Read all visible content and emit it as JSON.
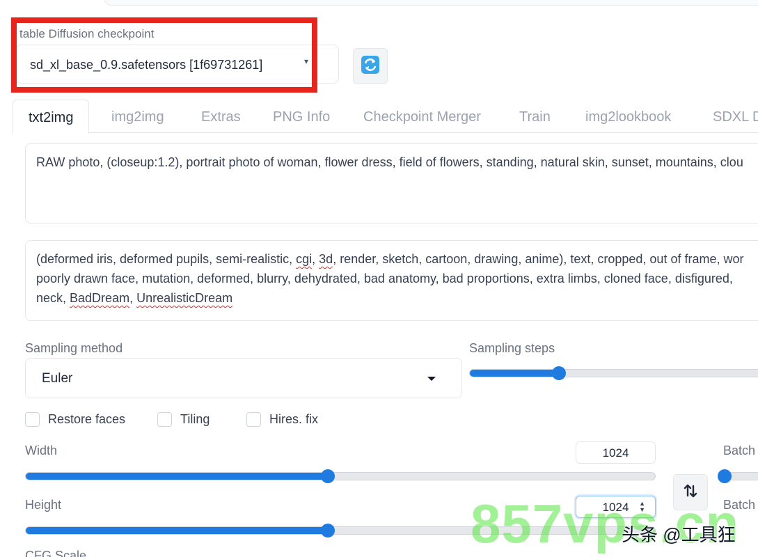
{
  "checkpoint": {
    "label": "table Diffusion checkpoint",
    "value": "sd_xl_base_0.9.safetensors [1f69731261]",
    "refresh_icon": "refresh-icon"
  },
  "tabs": [
    {
      "label": "txt2img",
      "active": true
    },
    {
      "label": "img2img",
      "active": false
    },
    {
      "label": "Extras",
      "active": false
    },
    {
      "label": "PNG Info",
      "active": false
    },
    {
      "label": "Checkpoint Merger",
      "active": false
    },
    {
      "label": "Train",
      "active": false
    },
    {
      "label": "img2lookbook",
      "active": false
    },
    {
      "label": "SDXL D",
      "active": false
    }
  ],
  "prompt": {
    "positive": "RAW photo, (closeup:1.2), portrait photo of  woman, flower dress, field of flowers, standing, natural skin, sunset, mountains, clou",
    "negative_line1_a": "(deformed iris, deformed pupils, semi-realistic, ",
    "negative_cgi": "cgi",
    "negative_sep": ", ",
    "negative_3d": "3d",
    "negative_line1_b": ", render, sketch, cartoon, drawing, anime), text, cropped, out of frame, wor",
    "negative_line2": "poorly drawn face, mutation, deformed, blurry, dehydrated, bad anatomy, bad proportions, extra limbs, cloned face, disfigured,",
    "negative_line3_a": "neck, ",
    "negative_baddream": "BadDream",
    "negative_line3_sep": ", ",
    "negative_unrealistic": "UnrealisticDream"
  },
  "sampling": {
    "method_label": "Sampling method",
    "method_value": "Euler",
    "steps_label": "Sampling steps",
    "steps_fraction": 0.3
  },
  "options": {
    "restore_faces": "Restore faces",
    "tiling": "Tiling",
    "hires_fix": "Hires. fix"
  },
  "dimensions": {
    "width_label": "Width",
    "width_value": "1024",
    "height_label": "Height",
    "height_value": "1024",
    "width_fraction": 0.48,
    "height_fraction": 0.48,
    "swap_icon": "swap-icon"
  },
  "batch": {
    "count_label": "Batch",
    "size_label": "Batch",
    "count_fraction": 0.0
  },
  "cfg": {
    "label": "CFG Scale"
  },
  "watermark": {
    "text": "857vps.cn",
    "sub": "头条 @工具狂"
  },
  "colors": {
    "accent": "#1f7be0",
    "highlight": "#e8251c"
  }
}
